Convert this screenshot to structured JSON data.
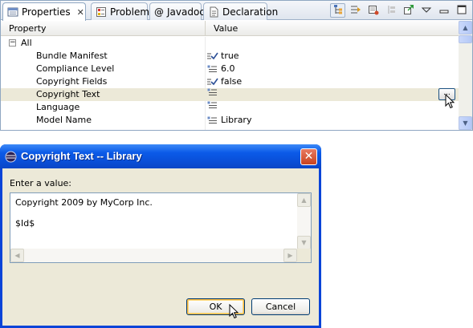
{
  "properties_view": {
    "tabs": [
      {
        "label": "Properties",
        "icon": "properties-icon",
        "active": true,
        "close": "✕"
      },
      {
        "label": "Problems",
        "icon": "problems-icon"
      },
      {
        "label": "Javadoc",
        "icon": "at-sign-icon",
        "glyph": "@"
      },
      {
        "label": "Declaration",
        "icon": "declaration-icon"
      }
    ],
    "toolbar": [
      "show-categories-icon",
      "show-advanced-icon",
      "restore-default-icon",
      "link-icon",
      "pin-icon",
      "view-menu-icon",
      "minimize-icon",
      "maximize-icon"
    ],
    "columns": [
      "Property",
      "Value"
    ],
    "category": {
      "label": "All",
      "expander": "−"
    },
    "rows": [
      {
        "name": "Bundle Manifest",
        "value": "true",
        "icon": "checkbox-value-icon"
      },
      {
        "name": "Compliance Level",
        "value": "6.0",
        "icon": "list-value-icon"
      },
      {
        "name": "Copyright Fields",
        "value": "false",
        "icon": "checkbox-value-icon"
      },
      {
        "name": "Copyright Text",
        "value": "",
        "icon": "list-value-icon",
        "selected": true
      },
      {
        "name": "Language",
        "value": "",
        "icon": "list-value-icon"
      },
      {
        "name": "Model Name",
        "value": "Library",
        "icon": "list-value-icon"
      }
    ],
    "edit_button_label": "..."
  },
  "dialog": {
    "title": "Copyright Text -- Library",
    "close_glyph": "✕",
    "prompt": "Enter a value:",
    "value_line1": "Copyright 2009 by MyCorp Inc.",
    "value_line2": "$Id$",
    "ok_label": "OK",
    "cancel_label": "Cancel"
  },
  "colors": {
    "titlebar": "#0a4fd8",
    "selected_row": "#ece9d8",
    "dialog_body": "#ece9d8",
    "close_button": "#c9431f"
  }
}
